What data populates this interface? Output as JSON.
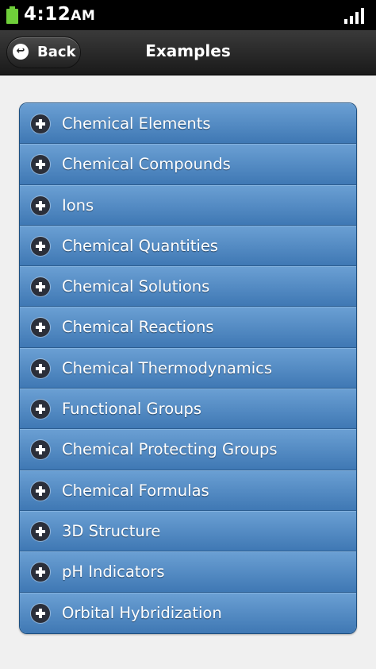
{
  "status_bar": {
    "time": "4:12",
    "ampm": "AM",
    "battery_icon": "battery-icon",
    "signal_icon": "signal-icon",
    "battery_color": "#6fcf3a"
  },
  "header": {
    "back_label": "Back",
    "back_icon": "back-arrow-icon",
    "title": "Examples"
  },
  "list": {
    "item_icon": "plus-icon",
    "items": [
      {
        "label": "Chemical Elements"
      },
      {
        "label": "Chemical Compounds"
      },
      {
        "label": "Ions"
      },
      {
        "label": "Chemical Quantities"
      },
      {
        "label": "Chemical Solutions"
      },
      {
        "label": "Chemical Reactions"
      },
      {
        "label": "Chemical Thermodynamics"
      },
      {
        "label": "Functional Groups"
      },
      {
        "label": "Chemical Protecting Groups"
      },
      {
        "label": "Chemical Formulas"
      },
      {
        "label": "3D Structure"
      },
      {
        "label": "pH Indicators"
      },
      {
        "label": "Orbital Hybridization"
      }
    ]
  }
}
